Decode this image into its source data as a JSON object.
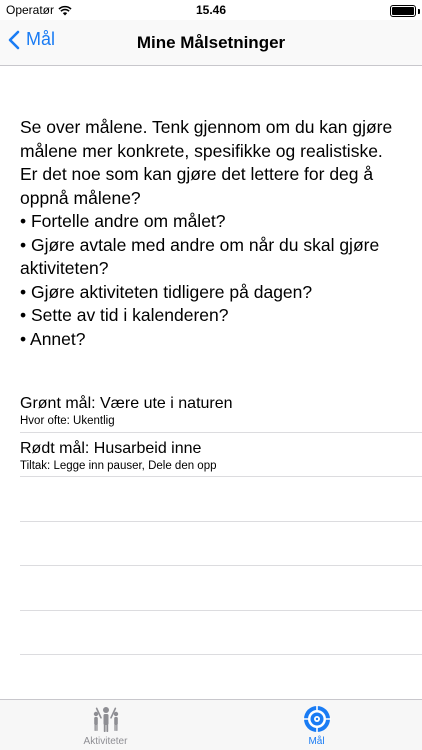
{
  "status_bar": {
    "carrier": "Operatør",
    "time": "15.46"
  },
  "nav": {
    "back_label": "Mål",
    "title": "Mine Målsetninger"
  },
  "intro": {
    "lines": [
      "Se over målene. Tenk gjennom om du kan gjøre målene mer konkrete, spesifikke og realistiske.",
      "Er det noe som kan gjøre det lettere for deg å oppnå målene?",
      "• Fortelle andre om målet?",
      "• Gjøre avtale med andre om når du skal gjøre aktiviteten?",
      "• Gjøre aktiviteten tidligere på dagen?",
      "• Sette av tid i kalenderen?",
      "• Annet?"
    ]
  },
  "goals": [
    {
      "title": "Grønt mål: Være ute i naturen",
      "subtitle": "Hvor ofte: Ukentlig"
    },
    {
      "title": "Rødt mål: Husarbeid inne",
      "subtitle": "Tiltak: Legge inn pauser, Dele den opp"
    }
  ],
  "tabs": [
    {
      "label": "Aktiviteter",
      "icon": "activities-icon",
      "active": false
    },
    {
      "label": "Mål",
      "icon": "target-icon",
      "active": true
    }
  ],
  "colors": {
    "accent": "#1a7cf4",
    "inactive": "#8e8e93"
  }
}
